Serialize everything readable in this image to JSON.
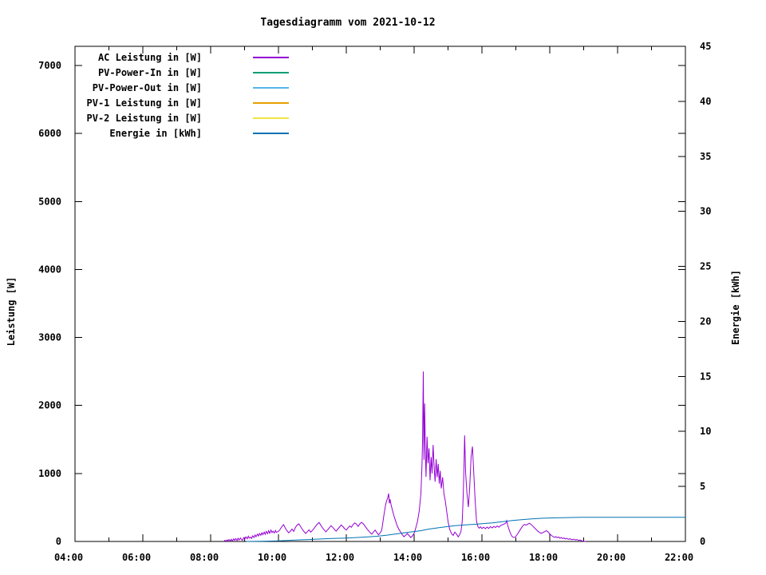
{
  "title": "Tagesdiagramm vom 2021-10-12",
  "legend": {
    "items": [
      {
        "label": "AC Leistung in [W]",
        "color": "#9400d3",
        "series": "ac_leistung"
      },
      {
        "label": "PV-Power-In in [W]",
        "color": "#009e73",
        "series": "pv_power_in"
      },
      {
        "label": "PV-Power-Out in [W]",
        "color": "#56b4e9",
        "series": "pv_power_out"
      },
      {
        "label": "PV-1 Leistung in [W]",
        "color": "#e69f00",
        "series": "pv1_leistung"
      },
      {
        "label": "PV-2 Leistung in [W]",
        "color": "#f0e442",
        "series": "pv2_leistung"
      },
      {
        "label": "Energie in [kWh]",
        "color": "#0072b2",
        "series": "energie"
      }
    ]
  },
  "chart_data": {
    "type": "line",
    "title": "Tagesdiagramm vom 2021-10-12",
    "x_axis": {
      "unit": "time of day (hours)",
      "range": [
        4,
        22
      ],
      "tick_labels": [
        "04:00",
        "06:00",
        "08:00",
        "10:00",
        "12:00",
        "14:00",
        "16:00",
        "18:00",
        "20:00",
        "22:00"
      ],
      "minor_tick_every_hours": 1
    },
    "y_axis": {
      "label": "Leistung [W]",
      "ticks": [
        0,
        1000,
        2000,
        3000,
        4000,
        5000,
        6000,
        7000
      ],
      "range": [
        0,
        7282
      ]
    },
    "y2_axis": {
      "label": "Energie [kWh]",
      "ticks": [
        0,
        5,
        10,
        15,
        20,
        25,
        30,
        35,
        40,
        45
      ],
      "range": [
        0,
        45
      ]
    },
    "grid": false,
    "legend_position": "top-left-inside",
    "series": [
      {
        "id": "ac_leistung",
        "name": "AC Leistung in [W]",
        "color": "#9400d3",
        "axis": "y1",
        "points": [
          [
            8.38,
            0
          ],
          [
            8.42,
            15
          ],
          [
            8.45,
            4
          ],
          [
            8.48,
            22
          ],
          [
            8.51,
            8
          ],
          [
            8.54,
            28
          ],
          [
            8.58,
            10
          ],
          [
            8.61,
            32
          ],
          [
            8.64,
            6
          ],
          [
            8.68,
            38
          ],
          [
            8.71,
            18
          ],
          [
            8.74,
            42
          ],
          [
            8.78,
            14
          ],
          [
            8.81,
            48
          ],
          [
            8.84,
            22
          ],
          [
            8.88,
            52
          ],
          [
            8.91,
            28
          ],
          [
            8.94,
            18
          ],
          [
            8.98,
            58
          ],
          [
            9.01,
            34
          ],
          [
            9.04,
            68
          ],
          [
            9.08,
            40
          ],
          [
            9.11,
            78
          ],
          [
            9.14,
            48
          ],
          [
            9.18,
            64
          ],
          [
            9.21,
            44
          ],
          [
            9.24,
            82
          ],
          [
            9.28,
            60
          ],
          [
            9.31,
            95
          ],
          [
            9.34,
            70
          ],
          [
            9.38,
            108
          ],
          [
            9.41,
            80
          ],
          [
            9.44,
            118
          ],
          [
            9.48,
            90
          ],
          [
            9.51,
            128
          ],
          [
            9.54,
            100
          ],
          [
            9.58,
            138
          ],
          [
            9.61,
            105
          ],
          [
            9.64,
            148
          ],
          [
            9.68,
            115
          ],
          [
            9.71,
            158
          ],
          [
            9.74,
            120
          ],
          [
            9.78,
            168
          ],
          [
            9.81,
            130
          ],
          [
            9.84,
            152
          ],
          [
            9.88,
            124
          ],
          [
            9.91,
            162
          ],
          [
            9.94,
            134
          ],
          [
            10.0,
            148
          ],
          [
            10.05,
            178
          ],
          [
            10.1,
            218
          ],
          [
            10.15,
            248
          ],
          [
            10.2,
            198
          ],
          [
            10.25,
            158
          ],
          [
            10.3,
            128
          ],
          [
            10.35,
            152
          ],
          [
            10.4,
            182
          ],
          [
            10.45,
            148
          ],
          [
            10.5,
            208
          ],
          [
            10.55,
            242
          ],
          [
            10.6,
            258
          ],
          [
            10.65,
            222
          ],
          [
            10.7,
            182
          ],
          [
            10.75,
            148
          ],
          [
            10.8,
            118
          ],
          [
            10.85,
            142
          ],
          [
            10.9,
            172
          ],
          [
            10.95,
            138
          ],
          [
            11.0,
            162
          ],
          [
            11.05,
            192
          ],
          [
            11.1,
            228
          ],
          [
            11.15,
            258
          ],
          [
            11.2,
            278
          ],
          [
            11.25,
            238
          ],
          [
            11.3,
            198
          ],
          [
            11.35,
            168
          ],
          [
            11.4,
            142
          ],
          [
            11.45,
            172
          ],
          [
            11.5,
            202
          ],
          [
            11.55,
            232
          ],
          [
            11.6,
            208
          ],
          [
            11.65,
            178
          ],
          [
            11.7,
            152
          ],
          [
            11.75,
            182
          ],
          [
            11.8,
            212
          ],
          [
            11.85,
            242
          ],
          [
            11.9,
            218
          ],
          [
            11.95,
            188
          ],
          [
            12.0,
            168
          ],
          [
            12.05,
            198
          ],
          [
            12.1,
            228
          ],
          [
            12.15,
            208
          ],
          [
            12.2,
            248
          ],
          [
            12.25,
            272
          ],
          [
            12.3,
            252
          ],
          [
            12.35,
            222
          ],
          [
            12.4,
            258
          ],
          [
            12.45,
            282
          ],
          [
            12.5,
            258
          ],
          [
            12.55,
            228
          ],
          [
            12.6,
            192
          ],
          [
            12.65,
            162
          ],
          [
            12.7,
            132
          ],
          [
            12.75,
            108
          ],
          [
            12.8,
            138
          ],
          [
            12.85,
            168
          ],
          [
            12.9,
            130
          ],
          [
            12.95,
            98
          ],
          [
            13.0,
            128
          ],
          [
            13.04,
            160
          ],
          [
            13.07,
            250
          ],
          [
            13.1,
            360
          ],
          [
            13.13,
            450
          ],
          [
            13.16,
            540
          ],
          [
            13.19,
            600
          ],
          [
            13.22,
            640
          ],
          [
            13.25,
            705
          ],
          [
            13.27,
            560
          ],
          [
            13.29,
            620
          ],
          [
            13.32,
            540
          ],
          [
            13.35,
            480
          ],
          [
            13.38,
            420
          ],
          [
            13.42,
            350
          ],
          [
            13.46,
            290
          ],
          [
            13.5,
            230
          ],
          [
            13.55,
            180
          ],
          [
            13.6,
            140
          ],
          [
            13.65,
            100
          ],
          [
            13.7,
            70
          ],
          [
            13.75,
            92
          ],
          [
            13.8,
            118
          ],
          [
            13.85,
            88
          ],
          [
            13.9,
            58
          ],
          [
            13.95,
            82
          ],
          [
            14.0,
            120
          ],
          [
            14.05,
            200
          ],
          [
            14.1,
            300
          ],
          [
            14.15,
            450
          ],
          [
            14.2,
            700
          ],
          [
            14.23,
            1100
          ],
          [
            14.25,
            1500
          ],
          [
            14.27,
            2500
          ],
          [
            14.29,
            1200
          ],
          [
            14.31,
            2030
          ],
          [
            14.33,
            1400
          ],
          [
            14.35,
            950
          ],
          [
            14.38,
            1540
          ],
          [
            14.41,
            1150
          ],
          [
            14.44,
            1370
          ],
          [
            14.47,
            900
          ],
          [
            14.5,
            1240
          ],
          [
            14.53,
            1000
          ],
          [
            14.56,
            1420
          ],
          [
            14.59,
            1090
          ],
          [
            14.62,
            880
          ],
          [
            14.65,
            1210
          ],
          [
            14.68,
            945
          ],
          [
            14.71,
            1140
          ],
          [
            14.74,
            850
          ],
          [
            14.77,
            1040
          ],
          [
            14.8,
            780
          ],
          [
            14.84,
            945
          ],
          [
            14.88,
            700
          ],
          [
            14.92,
            595
          ],
          [
            14.96,
            445
          ],
          [
            15.0,
            295
          ],
          [
            15.05,
            178
          ],
          [
            15.1,
            118
          ],
          [
            15.15,
            88
          ],
          [
            15.2,
            138
          ],
          [
            15.25,
            108
          ],
          [
            15.3,
            68
          ],
          [
            15.34,
            98
          ],
          [
            15.38,
            148
          ],
          [
            15.42,
            295
          ],
          [
            15.45,
            695
          ],
          [
            15.47,
            1095
          ],
          [
            15.49,
            1560
          ],
          [
            15.52,
            1000
          ],
          [
            15.56,
            700
          ],
          [
            15.6,
            505
          ],
          [
            15.64,
            800
          ],
          [
            15.68,
            1245
          ],
          [
            15.72,
            1395
          ],
          [
            15.76,
            1000
          ],
          [
            15.8,
            600
          ],
          [
            15.84,
            300
          ],
          [
            15.88,
            220
          ],
          [
            15.92,
            195
          ],
          [
            15.96,
            215
          ],
          [
            16.0,
            190
          ],
          [
            16.05,
            210
          ],
          [
            16.1,
            188
          ],
          [
            16.15,
            212
          ],
          [
            16.2,
            192
          ],
          [
            16.25,
            218
          ],
          [
            16.3,
            198
          ],
          [
            16.35,
            222
          ],
          [
            16.4,
            205
          ],
          [
            16.45,
            228
          ],
          [
            16.5,
            210
          ],
          [
            16.55,
            235
          ],
          [
            16.6,
            245
          ],
          [
            16.65,
            255
          ],
          [
            16.7,
            270
          ],
          [
            16.73,
            306
          ],
          [
            16.76,
            240
          ],
          [
            16.8,
            175
          ],
          [
            16.84,
            120
          ],
          [
            16.88,
            80
          ],
          [
            16.92,
            62
          ],
          [
            16.96,
            58
          ],
          [
            17.0,
            75
          ],
          [
            17.05,
            110
          ],
          [
            17.1,
            150
          ],
          [
            17.15,
            190
          ],
          [
            17.2,
            225
          ],
          [
            17.25,
            250
          ],
          [
            17.3,
            240
          ],
          [
            17.35,
            255
          ],
          [
            17.4,
            268
          ],
          [
            17.45,
            250
          ],
          [
            17.5,
            225
          ],
          [
            17.55,
            200
          ],
          [
            17.6,
            175
          ],
          [
            17.65,
            150
          ],
          [
            17.7,
            132
          ],
          [
            17.75,
            120
          ],
          [
            17.8,
            132
          ],
          [
            17.85,
            145
          ],
          [
            17.9,
            158
          ],
          [
            17.95,
            140
          ],
          [
            18.0,
            112
          ],
          [
            18.05,
            88
          ],
          [
            18.1,
            70
          ],
          [
            18.14,
            60
          ],
          [
            18.18,
            70
          ],
          [
            18.22,
            55
          ],
          [
            18.26,
            65
          ],
          [
            18.3,
            48
          ],
          [
            18.34,
            58
          ],
          [
            18.38,
            42
          ],
          [
            18.42,
            52
          ],
          [
            18.46,
            36
          ],
          [
            18.5,
            46
          ],
          [
            18.55,
            32
          ],
          [
            18.6,
            40
          ],
          [
            18.65,
            26
          ],
          [
            18.7,
            34
          ],
          [
            18.75,
            22
          ],
          [
            18.8,
            28
          ],
          [
            18.85,
            16
          ],
          [
            18.9,
            20
          ],
          [
            18.95,
            8
          ],
          [
            19.0,
            4
          ],
          [
            19.05,
            0
          ]
        ]
      },
      {
        "id": "pv_power_in",
        "name": "PV-Power-In in [W]",
        "color": "#009e73",
        "axis": "y1",
        "points": []
      },
      {
        "id": "pv_power_out",
        "name": "PV-Power-Out in [W]",
        "color": "#56b4e9",
        "axis": "y1",
        "points": []
      },
      {
        "id": "pv1_leistung",
        "name": "PV-1 Leistung in [W]",
        "color": "#e69f00",
        "axis": "y1",
        "points": []
      },
      {
        "id": "pv2_leistung",
        "name": "PV-2 Leistung in [W]",
        "color": "#f0e442",
        "axis": "y1",
        "points": []
      },
      {
        "id": "energie",
        "name": "Energie in [kWh]",
        "color": "#0072b2",
        "axis": "y2",
        "points": [
          [
            9.05,
            0.0
          ],
          [
            9.5,
            0.02
          ],
          [
            10.0,
            0.06
          ],
          [
            10.5,
            0.12
          ],
          [
            11.0,
            0.19
          ],
          [
            11.5,
            0.26
          ],
          [
            12.0,
            0.31
          ],
          [
            12.5,
            0.39
          ],
          [
            12.9,
            0.47
          ],
          [
            13.2,
            0.57
          ],
          [
            13.5,
            0.7
          ],
          [
            13.8,
            0.83
          ],
          [
            14.0,
            0.9
          ],
          [
            14.2,
            0.98
          ],
          [
            14.4,
            1.1
          ],
          [
            14.6,
            1.2
          ],
          [
            14.8,
            1.28
          ],
          [
            15.0,
            1.36
          ],
          [
            15.2,
            1.43
          ],
          [
            15.5,
            1.5
          ],
          [
            15.8,
            1.56
          ],
          [
            16.0,
            1.61
          ],
          [
            16.3,
            1.69
          ],
          [
            16.6,
            1.79
          ],
          [
            16.9,
            1.9
          ],
          [
            17.2,
            1.99
          ],
          [
            17.5,
            2.06
          ],
          [
            17.8,
            2.11
          ],
          [
            18.1,
            2.14
          ],
          [
            18.5,
            2.17
          ],
          [
            18.9,
            2.19
          ],
          [
            19.3,
            2.2
          ],
          [
            20.0,
            2.2
          ],
          [
            21.0,
            2.2
          ],
          [
            22.0,
            2.2
          ]
        ]
      }
    ]
  }
}
